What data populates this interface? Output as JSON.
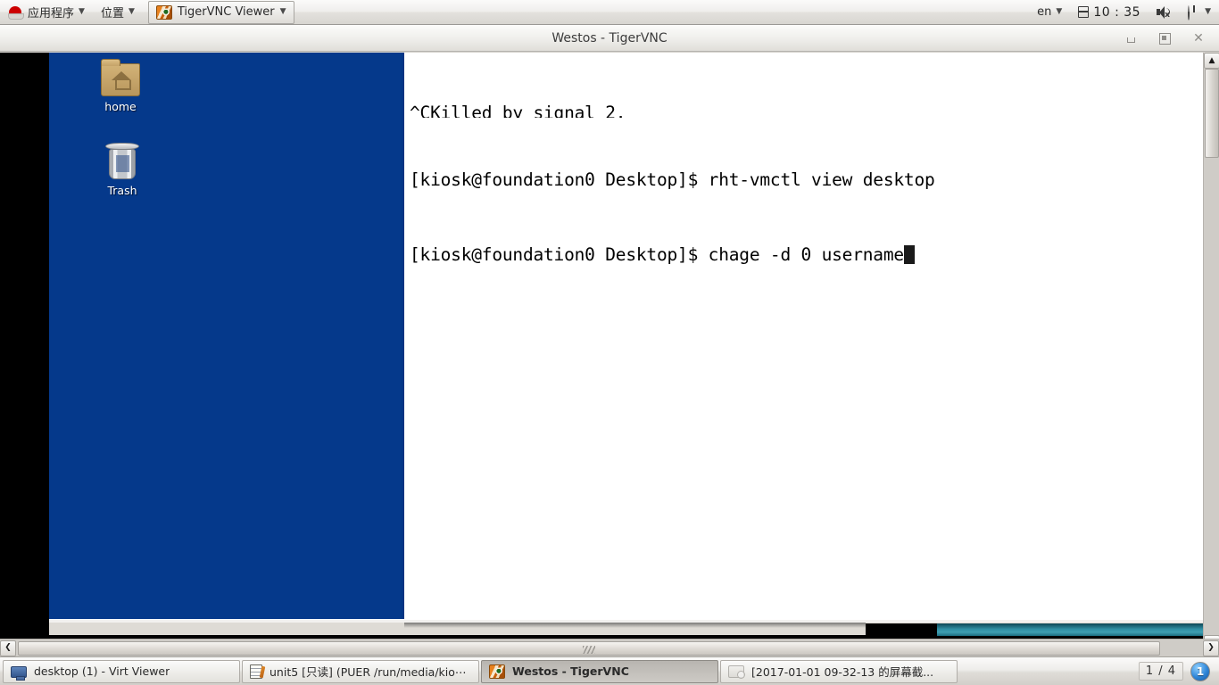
{
  "top_panel": {
    "applications_menu": "应用程序",
    "places_menu": "位置",
    "window_button": "TigerVNC Viewer",
    "keyboard_layout": "en",
    "clock": "10 : 35",
    "icons": {
      "redhat": "redhat-logo-icon",
      "calendar": "calendar-icon",
      "volume": "volume-muted-icon",
      "power": "power-icon"
    }
  },
  "vnc_window": {
    "title": "Westos - TigerVNC",
    "buttons": {
      "minimize": "minimize-button",
      "maximize": "maximize-button",
      "close": "close-button"
    }
  },
  "remote_desktop": {
    "icons": [
      {
        "label": "home",
        "type": "folder-home-icon"
      },
      {
        "label": "Trash",
        "type": "trash-icon"
      }
    ],
    "terminal": {
      "lines": [
        "^CKilled by signal 2.",
        "[kiosk@foundation0 Desktop]$ rht-vmctl view desktop",
        "[kiosk@foundation0 Desktop]$ chage -d 0 username"
      ],
      "line0": "^CKilled by signal 2.",
      "line1": "[kiosk@foundation0 Desktop]$ rht-vmctl view desktop",
      "line2": "[kiosk@foundation0 Desktop]$ chage -d 0 username",
      "cursor": "block"
    }
  },
  "scrollbars": {
    "vertical_up_arrow": "▲",
    "vertical_down_arrow": "▼",
    "horizontal_left_arrow": "❮",
    "horizontal_right_arrow": "❯"
  },
  "bottom_panel": {
    "tasks": [
      {
        "label": "desktop (1) - Virt Viewer",
        "icon": "monitor-icon",
        "active": false
      },
      {
        "label": "unit5 [只读] (PUER /run/media/kio⋯",
        "icon": "document-icon",
        "active": false
      },
      {
        "label": "Westos - TigerVNC",
        "icon": "tigervnc-icon",
        "active": true
      },
      {
        "label": "[2017-01-01 09-32-13 的屏幕截...",
        "icon": "screenshot-icon",
        "active": false
      }
    ],
    "workspace_label": "1 / 4",
    "workspace_current": "1"
  },
  "colors": {
    "desktop_blue": "#05398b",
    "panel_gray": "#d6d3ce",
    "taskbar_teal": "#2e8ea3",
    "terminal_bg": "#ffffff",
    "terminal_fg": "#000000"
  }
}
